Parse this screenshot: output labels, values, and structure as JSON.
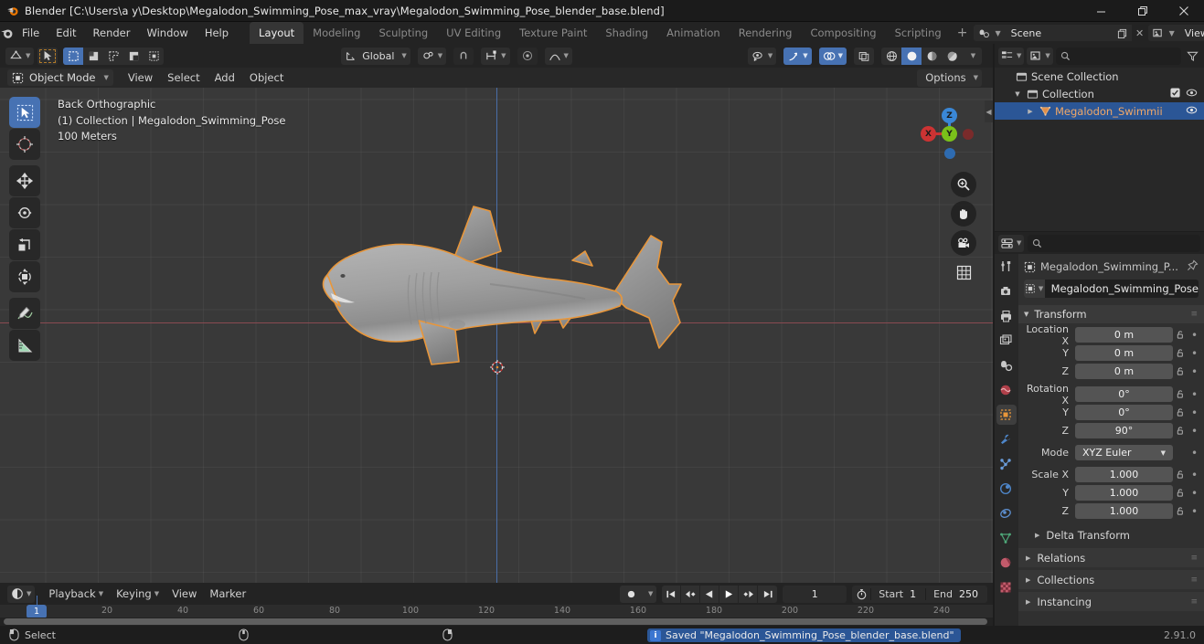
{
  "window": {
    "title": "Blender [C:\\Users\\a y\\Desktop\\Megalodon_Swimming_Pose_max_vray\\Megalodon_Swimming_Pose_blender_base.blend]",
    "minimize_label": "Minimize",
    "maximize_label": "Restore",
    "close_label": "Close"
  },
  "topbar": {
    "menus": [
      "File",
      "Edit",
      "Render",
      "Window",
      "Help"
    ],
    "workspaces": [
      {
        "label": "Layout",
        "active": true
      },
      {
        "label": "Modeling",
        "active": false
      },
      {
        "label": "Sculpting",
        "active": false
      },
      {
        "label": "UV Editing",
        "active": false
      },
      {
        "label": "Texture Paint",
        "active": false
      },
      {
        "label": "Shading",
        "active": false
      },
      {
        "label": "Animation",
        "active": false
      },
      {
        "label": "Rendering",
        "active": false
      },
      {
        "label": "Compositing",
        "active": false
      },
      {
        "label": "Scripting",
        "active": false
      }
    ],
    "add_workspace": "+",
    "scene_name": "Scene",
    "view_layer_name": "View Layer"
  },
  "viewport": {
    "mode": "Object Mode",
    "menus": [
      "View",
      "Select",
      "Add",
      "Object"
    ],
    "transform_orientation": "Global",
    "options_label": "Options",
    "overlay_text": {
      "view_name": "Back Orthographic",
      "collection_object": "(1) Collection | Megalodon_Swimming_Pose",
      "grid_scale": "100 Meters"
    },
    "gizmo_axes": {
      "x": "X",
      "y": "Y",
      "z": "Z"
    },
    "tools": [
      "tweak-select-tool",
      "cursor-tool",
      "move-tool",
      "rotate-tool",
      "scale-tool",
      "transform-tool",
      "annotate-tool",
      "measure-tool"
    ],
    "nav_buttons": [
      "zoom-icon",
      "pan-hand-icon",
      "camera-icon",
      "grid-ortho-icon"
    ]
  },
  "outliner": {
    "search_placeholder": "",
    "rows": [
      {
        "label": "Scene Collection",
        "icon": "collection-icon",
        "indent": 0,
        "selected": false,
        "disclosure": "",
        "checkbox": false,
        "eye": false
      },
      {
        "label": "Collection",
        "icon": "collection-icon",
        "indent": 1,
        "selected": false,
        "disclosure": "down",
        "checkbox": true,
        "eye": true
      },
      {
        "label": "Megalodon_Swimmii",
        "icon": "mesh-object-icon",
        "indent": 2,
        "selected": true,
        "disclosure": "right",
        "checkbox": false,
        "eye": true
      }
    ]
  },
  "properties": {
    "search_placeholder": "",
    "tabs": [
      "tool-tab",
      "render-tab",
      "output-tab",
      "view-layer-tab",
      "scene-tab",
      "world-tab",
      "object-tab",
      "modifier-tab",
      "particles-tab",
      "physics-tab",
      "constraints-tab",
      "object-data-tab",
      "material-tab",
      "texture-tab"
    ],
    "active_tab": "object-tab",
    "breadcrumb": "Megalodon_Swimming_P...",
    "object_name": "Megalodon_Swimming_Pose",
    "transform_panel": {
      "title": "Transform",
      "rows": [
        {
          "label": "Location X",
          "value": "0 m"
        },
        {
          "label": "Y",
          "value": "0 m"
        },
        {
          "label": "Z",
          "value": "0 m"
        },
        {
          "label": "Rotation X",
          "value": "0°"
        },
        {
          "label": "Y",
          "value": "0°"
        },
        {
          "label": "Z",
          "value": "90°"
        }
      ],
      "mode_label": "Mode",
      "mode_value": "XYZ Euler",
      "scale_rows": [
        {
          "label": "Scale X",
          "value": "1.000"
        },
        {
          "label": "Y",
          "value": "1.000"
        },
        {
          "label": "Z",
          "value": "1.000"
        }
      ],
      "delta_transform": "Delta Transform"
    },
    "closed_panels": [
      "Relations",
      "Collections",
      "Instancing"
    ]
  },
  "timeline": {
    "menus": [
      "Playback",
      "Keying",
      "View",
      "Marker"
    ],
    "current_frame": "1",
    "start_label": "Start",
    "start_value": "1",
    "end_label": "End",
    "end_value": "250",
    "ruler_ticks": [
      "20",
      "40",
      "60",
      "80",
      "100",
      "120",
      "140",
      "160",
      "180",
      "200",
      "220",
      "240"
    ],
    "playhead_frame": "1",
    "playback_buttons": [
      "record-icon",
      "jump-to-start-icon",
      "previous-keyframe-icon",
      "play-reverse-icon",
      "play-icon",
      "next-keyframe-icon",
      "jump-to-end-icon"
    ]
  },
  "statusbar": {
    "mouse_hint": "Select",
    "message": "Saved \"Megalodon_Swimming_Pose_blender_base.blend\"",
    "version": "2.91.0"
  },
  "colors": {
    "accent_blue": "#4772b3",
    "select_orange": "#e89b3c",
    "axis_x_red": "#cc3333",
    "axis_y_green": "#7ac11a",
    "axis_z_blue": "#3a87d6"
  }
}
